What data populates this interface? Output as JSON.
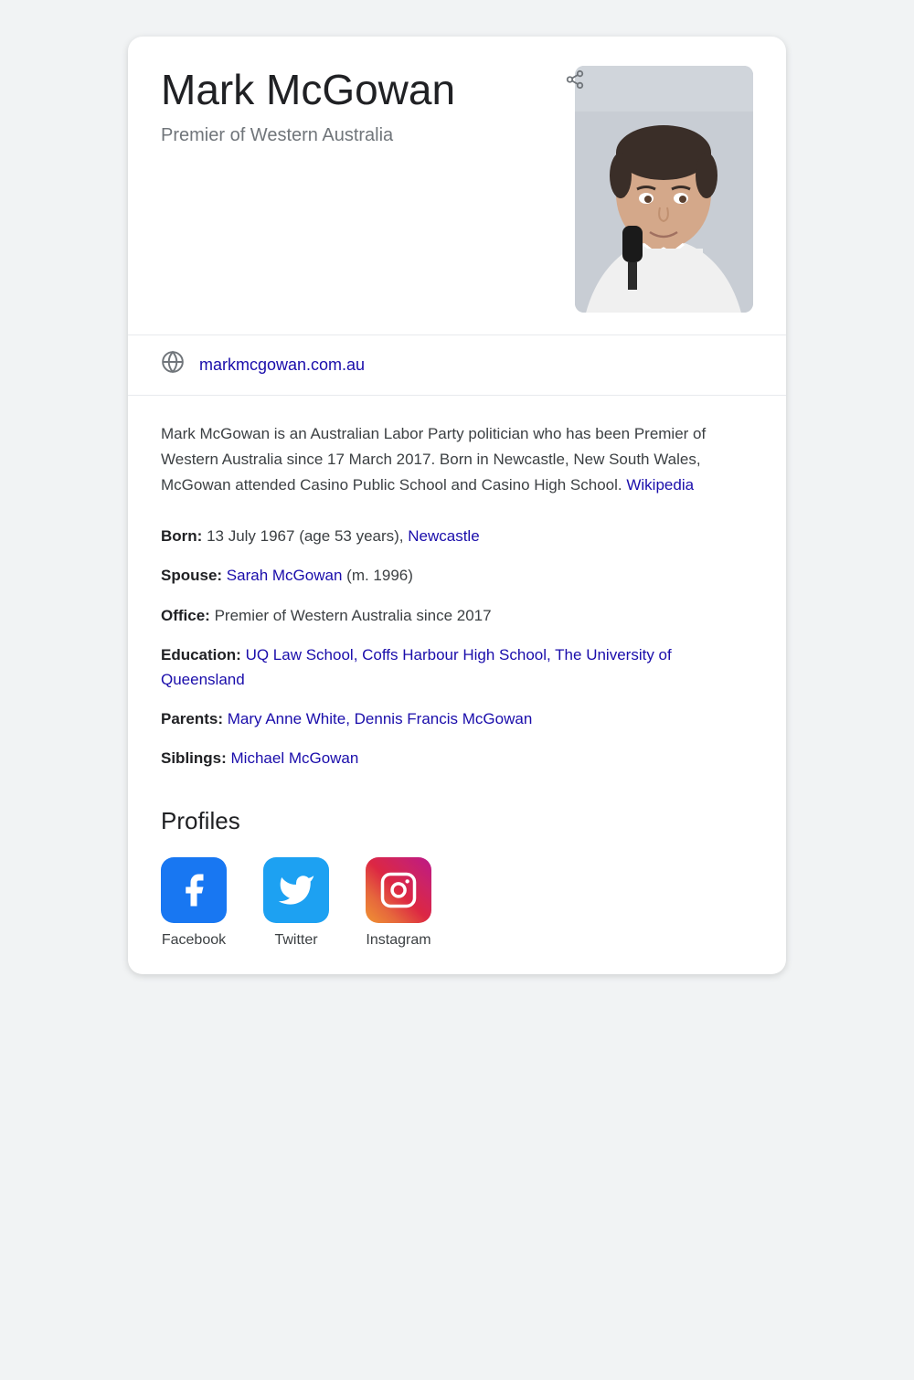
{
  "header": {
    "name": "Mark McGowan",
    "title": "Premier of Western Australia",
    "share_icon": "⋮"
  },
  "website": {
    "url_display": "markmcgowan.com.au",
    "url_href": "#"
  },
  "description": {
    "text": "Mark McGowan is an Australian Labor Party politician who has been Premier of Western Australia since 17 March 2017. Born in Newcastle, New South Wales, McGowan attended Casino Public School and Casino High School.",
    "wikipedia_label": "Wikipedia",
    "wikipedia_href": "#"
  },
  "facts": [
    {
      "label": "Born:",
      "text": " 13 July 1967 (age 53 years), ",
      "link_text": "Newcastle",
      "link_href": "#"
    },
    {
      "label": "Spouse:",
      "text": " ",
      "link_text": "Sarah McGowan",
      "link_href": "#",
      "suffix": " (m. 1996)"
    },
    {
      "label": "Office:",
      "text": " Premier of Western Australia since 2017",
      "link_text": null
    },
    {
      "label": "Education:",
      "text": " ",
      "link_text": "UQ Law School, Coffs Harbour High School, The University of Queensland",
      "link_href": "#"
    },
    {
      "label": "Parents:",
      "text": " ",
      "link_text": "Mary Anne White, Dennis Francis McGowan",
      "link_href": "#"
    },
    {
      "label": "Siblings:",
      "text": " ",
      "link_text": "Michael McGowan",
      "link_href": "#"
    }
  ],
  "profiles": {
    "title": "Profiles",
    "items": [
      {
        "name": "Facebook",
        "type": "facebook"
      },
      {
        "name": "Twitter",
        "type": "twitter"
      },
      {
        "name": "Instagram",
        "type": "instagram"
      }
    ]
  }
}
